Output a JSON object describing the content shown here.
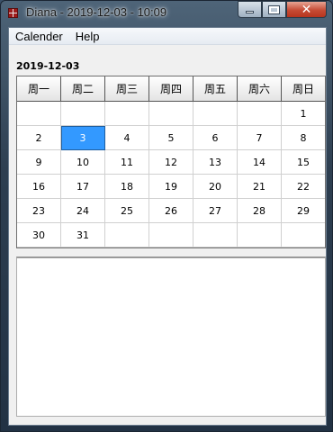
{
  "window": {
    "title": "Diana - 2019-12-03  -  10:09"
  },
  "menu": {
    "items": [
      "Calender",
      "Help"
    ]
  },
  "selected_date_label": "2019-12-03",
  "calendar": {
    "weekdays": [
      "周一",
      "周二",
      "周三",
      "周四",
      "周五",
      "周六",
      "周日"
    ],
    "weeks": [
      [
        "",
        "",
        "",
        "",
        "",
        "",
        "1"
      ],
      [
        "2",
        "3",
        "4",
        "5",
        "6",
        "7",
        "8"
      ],
      [
        "9",
        "10",
        "11",
        "12",
        "13",
        "14",
        "15"
      ],
      [
        "16",
        "17",
        "18",
        "19",
        "20",
        "21",
        "22"
      ],
      [
        "23",
        "24",
        "25",
        "26",
        "27",
        "28",
        "29"
      ],
      [
        "30",
        "31",
        "",
        "",
        "",
        "",
        ""
      ]
    ],
    "selected_day": "3",
    "selection_color": "#3399ff"
  },
  "notes": {
    "value": ""
  }
}
